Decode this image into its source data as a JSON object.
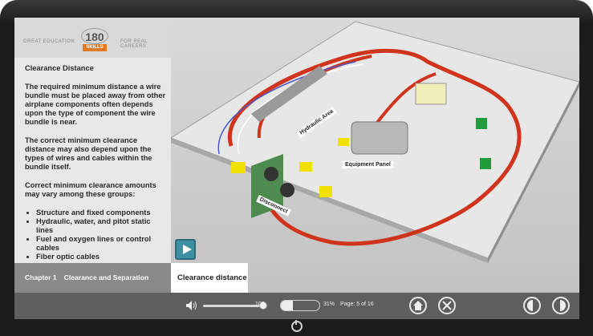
{
  "header": {
    "tagline_left": "GREAT EDUCATION",
    "tagline_right": "FOR REAL CAREERS",
    "logo_number": "180",
    "logo_word": "SKILLS"
  },
  "content": {
    "heading": "Clearance Distance",
    "paragraphs": [
      "The required minimum distance a wire bundle must be placed away from other airplane components often depends upon the type of component the wire bundle is near.",
      "The correct minimum clearance distance may also depend upon the types of wires and cables within the bundle itself.",
      "Correct minimum clearance amounts may vary among these groups:"
    ],
    "bullets": [
      "Structure and fixed components",
      "Hydraulic, water, and pitot static lines",
      "Fuel and oxygen lines or control cables",
      "Fiber optic cables"
    ]
  },
  "chapter": {
    "number": "Chapter 1",
    "title": "Clearance and Separation"
  },
  "scene": {
    "labels": {
      "hydraulic": "Hydraulic Area",
      "equipment": "Equipment Panel",
      "disconnect": "Disconnect"
    },
    "caption": "Clearance distance"
  },
  "controls": {
    "volume": "100",
    "volume_level": 1.0,
    "progress_percent": "31%",
    "progress_level": 0.31,
    "page_text": "Page: 5 of 16"
  },
  "icons": {
    "play": "play-icon",
    "volume": "speaker-icon",
    "home": "home-icon",
    "close": "close-icon",
    "prev": "previous-icon",
    "next": "next-icon"
  },
  "colors": {
    "accent_orange": "#e07a24",
    "play_teal": "#3d8fa3",
    "wire_red": "#d0341c",
    "tag_yellow": "#f2e000",
    "tag_green": "#1f9d3a"
  }
}
